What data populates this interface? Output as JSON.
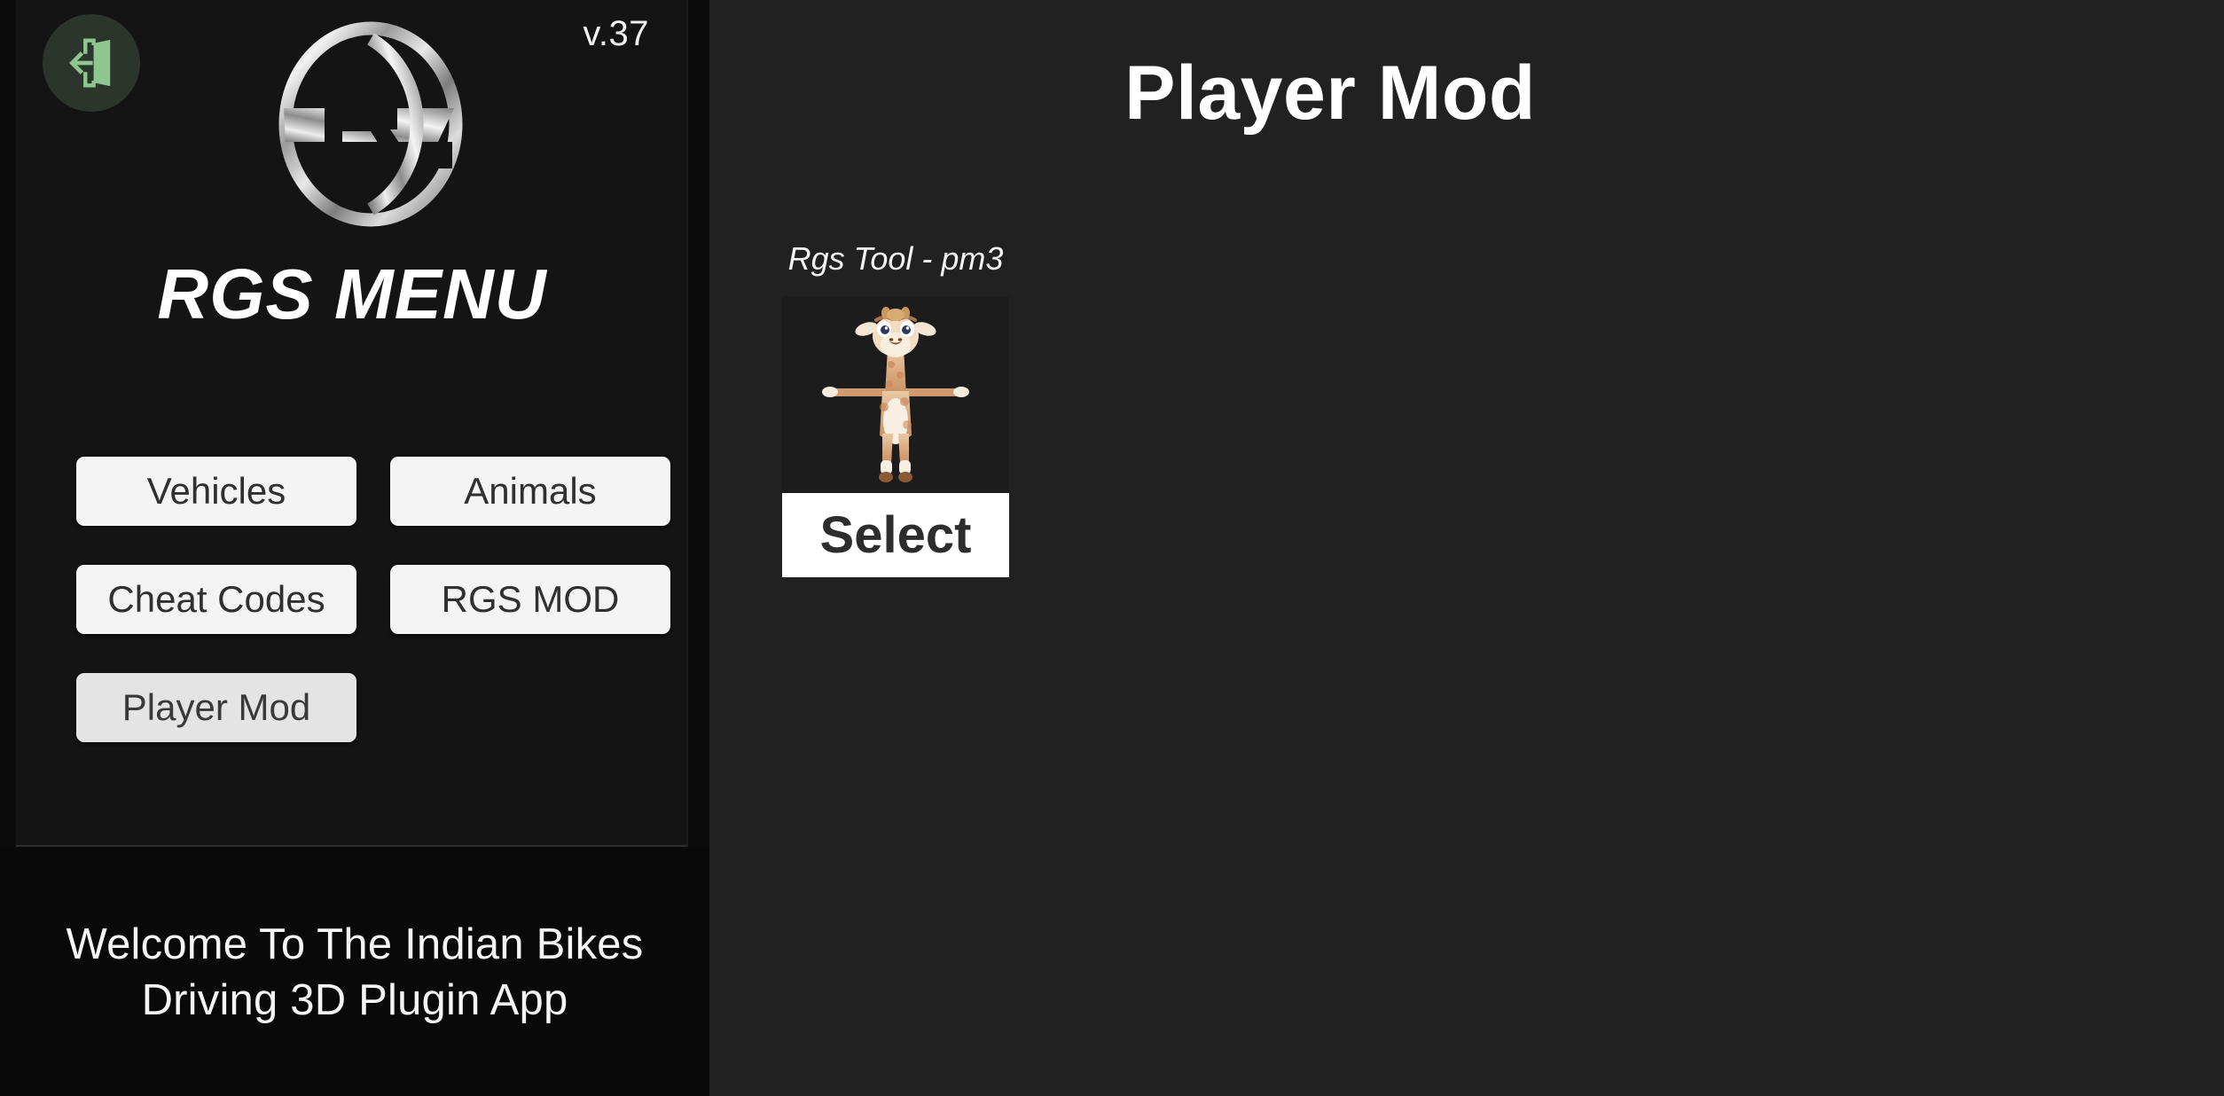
{
  "sidebar": {
    "exit_icon": "exit-door-icon",
    "version": "v.37",
    "logo_icon": "rgs-logo-icon",
    "title": "RGS MENU",
    "buttons": [
      {
        "label": "Vehicles",
        "active": false
      },
      {
        "label": "Animals",
        "active": false
      },
      {
        "label": "Cheat Codes",
        "active": false
      },
      {
        "label": "RGS MOD",
        "active": false
      },
      {
        "label": "Player Mod",
        "active": true
      }
    ],
    "welcome_text": "Welcome To The Indian Bikes Driving 3D Plugin App"
  },
  "content": {
    "title": "Player Mod",
    "items": [
      {
        "label": "Rgs Tool - pm3",
        "preview_icon": "giraffe-character-model",
        "select_label": "Select"
      }
    ]
  },
  "colors": {
    "sidebar_bg": "#0b0b0b",
    "panel_bg": "#141414",
    "content_bg": "#212121",
    "button_bg": "#f4f4f4",
    "button_active_bg": "#e4e4e4",
    "select_bg": "#ffffff",
    "exit_circle": "#2b352b",
    "exit_glyph": "#8fc68f",
    "text_light": "#ffffff"
  }
}
